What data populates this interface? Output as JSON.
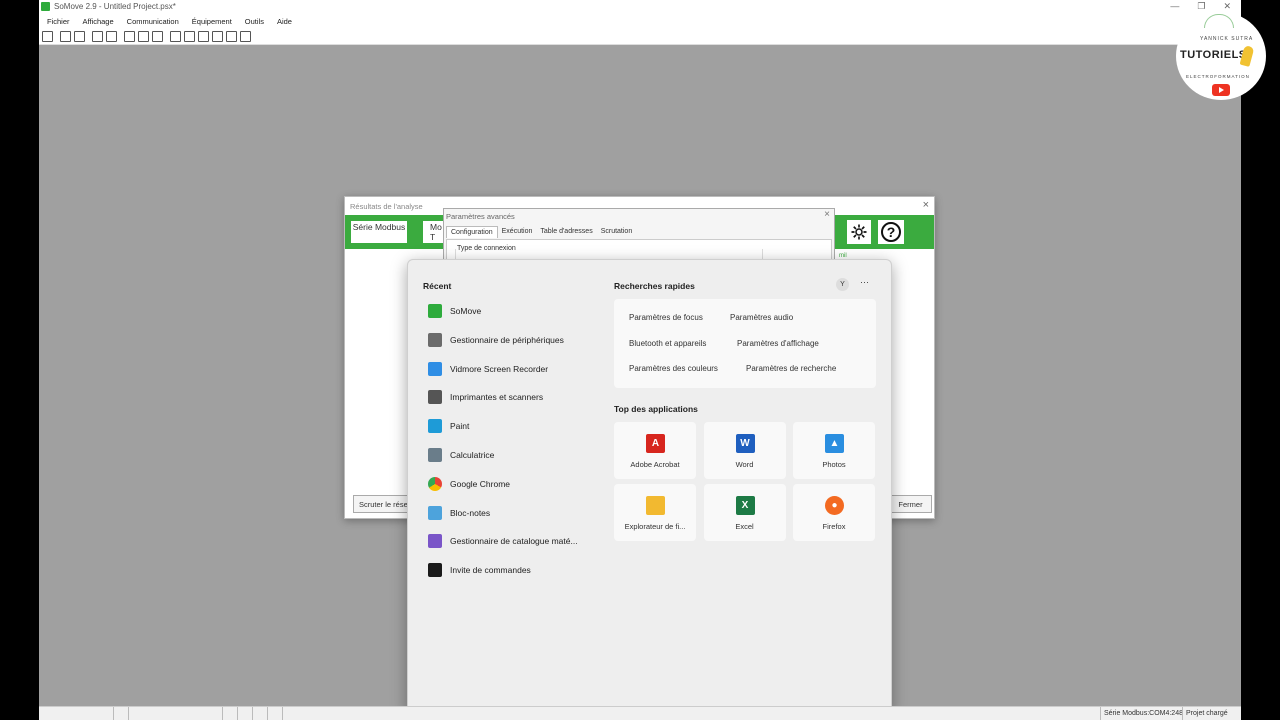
{
  "window": {
    "title": "SoMove 2.9 - Untitled Project.psx*",
    "controls": [
      "—",
      "❐",
      "✕"
    ]
  },
  "menu": [
    "Fichier",
    "Affichage",
    "Communication",
    "Équipement",
    "Outils",
    "Aide"
  ],
  "status_bar": {
    "connection": "Série Modbus:COM4:248",
    "project": "Projet chargé"
  },
  "results_dialog": {
    "title": "Résultats de l'analyse",
    "serie_button": "Série Modbus",
    "mode_button": "Mo T",
    "scan_button": "Scruter le réseau",
    "close_button": "Fermer",
    "link_fragment": "mil"
  },
  "advanced_dialog": {
    "title": "Paramètres avancés",
    "tabs": [
      "Configuration",
      "Exécution",
      "Table d'adresses",
      "Scrutation"
    ],
    "group_label": "Type de connexion"
  },
  "start_menu": {
    "recent_heading": "Récent",
    "recent": [
      {
        "label": "SoMove",
        "icon": "somove-icon",
        "color": "#2eab3c"
      },
      {
        "label": "Gestionnaire de périphériques",
        "icon": "device-manager-icon",
        "color": "#6b6b6b"
      },
      {
        "label": "Vidmore Screen Recorder",
        "icon": "video-recorder-icon",
        "color": "#2f8ee5"
      },
      {
        "label": "Imprimantes et scanners",
        "icon": "printer-icon",
        "color": "#555555"
      },
      {
        "label": "Paint",
        "icon": "paint-icon",
        "color": "#1e9bd7"
      },
      {
        "label": "Calculatrice",
        "icon": "calculator-icon",
        "color": "#6a7d8a"
      },
      {
        "label": "Google Chrome",
        "icon": "chrome-icon",
        "color": "#e94235"
      },
      {
        "label": "Bloc-notes",
        "icon": "notepad-icon",
        "color": "#4da3dc"
      },
      {
        "label": "Gestionnaire de catalogue maté...",
        "icon": "catalog-manager-icon",
        "color": "#7a55c8"
      },
      {
        "label": "Invite de commandes",
        "icon": "terminal-icon",
        "color": "#1a1a1a"
      }
    ],
    "quick_heading": "Recherches rapides",
    "avatar_letter": "Y",
    "more_label": "···",
    "quick_searches": [
      "Paramètres de focus",
      "Paramètres audio",
      "Bluetooth et appareils",
      "Paramètres d'affichage",
      "Paramètres des couleurs",
      "Paramètres de recherche"
    ],
    "top_apps_heading": "Top des applications",
    "top_apps": [
      {
        "label": "Adobe Acrobat",
        "icon": "acrobat-icon",
        "color": "#d7261e",
        "glyph": "A"
      },
      {
        "label": "Word",
        "icon": "word-icon",
        "color": "#1f5fbf",
        "glyph": "W"
      },
      {
        "label": "Photos",
        "icon": "photos-icon",
        "color": "#2a8ee0",
        "glyph": "▲"
      },
      {
        "label": "Explorateur de fi...",
        "icon": "file-explorer-icon",
        "color": "#f2b930",
        "glyph": ""
      },
      {
        "label": "Excel",
        "icon": "excel-icon",
        "color": "#1d7a45",
        "glyph": "X"
      },
      {
        "label": "Firefox",
        "icon": "firefox-icon",
        "color": "#f36a21",
        "glyph": "●"
      }
    ]
  },
  "watermark": {
    "author": "YANNICK SUTRA",
    "brand": "TUTORIELS",
    "subtitle": "ELECTROFORMATION"
  }
}
